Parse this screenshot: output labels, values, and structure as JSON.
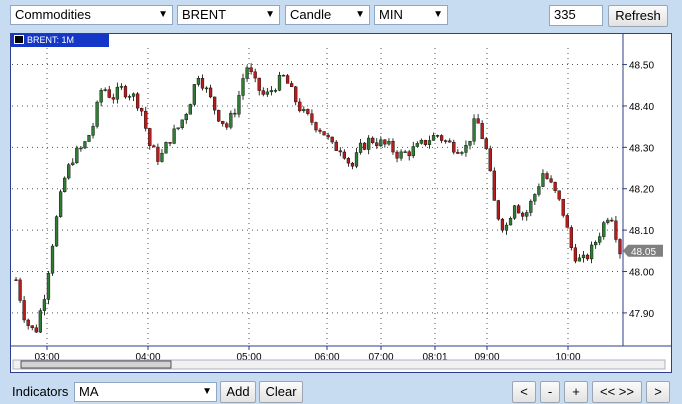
{
  "toolbar": {
    "category": "Commodities",
    "symbol": "BRENT",
    "chart_type": "Candle",
    "interval": "MIN",
    "bars_count": "335",
    "refresh_label": "Refresh"
  },
  "chart": {
    "legend_label": "BRENT: 1M",
    "current_price": "48.05"
  },
  "bottom": {
    "indicators_label": "Indicators",
    "indicator_value": "MA",
    "add_label": "Add",
    "clear_label": "Clear",
    "nav_prev": "<",
    "zoom_out": "-",
    "zoom_in": "+",
    "nav_all": "<< >>",
    "nav_next": ">"
  },
  "colors": {
    "up": "#2e7d32",
    "down": "#b71c1c",
    "title_bg": "#1537c7",
    "price_tag_bg": "#808080"
  },
  "chart_data": {
    "type": "candlestick",
    "ylim": [
      47.82,
      48.54
    ],
    "yticks": [
      "48.50",
      "48.40",
      "48.30",
      "48.20",
      "48.10",
      "48.00",
      "47.90"
    ],
    "xticks": [
      "03:00",
      "04:00",
      "05:00",
      "06:00",
      "07:00",
      "08:01",
      "09:00",
      "10:00"
    ],
    "grid": true,
    "price_path": [
      47.98,
      47.88,
      47.85,
      47.95,
      48.1,
      48.22,
      48.28,
      48.3,
      48.35,
      48.45,
      48.42,
      48.44,
      48.43,
      48.4,
      48.3,
      48.27,
      48.32,
      48.35,
      48.4,
      48.48,
      48.43,
      48.38,
      48.35,
      48.4,
      48.5,
      48.45,
      48.42,
      48.45,
      48.47,
      48.42,
      48.38,
      48.36,
      48.34,
      48.3,
      48.3,
      48.25,
      48.3,
      48.32,
      48.31,
      48.3,
      48.28,
      48.29,
      48.3,
      48.32,
      48.33,
      48.31,
      48.3,
      48.3,
      48.37,
      48.3,
      48.15,
      48.1,
      48.17,
      48.13,
      48.18,
      48.24,
      48.2,
      48.15,
      48.05,
      48.02,
      48.05,
      48.1,
      48.15,
      48.05
    ]
  }
}
